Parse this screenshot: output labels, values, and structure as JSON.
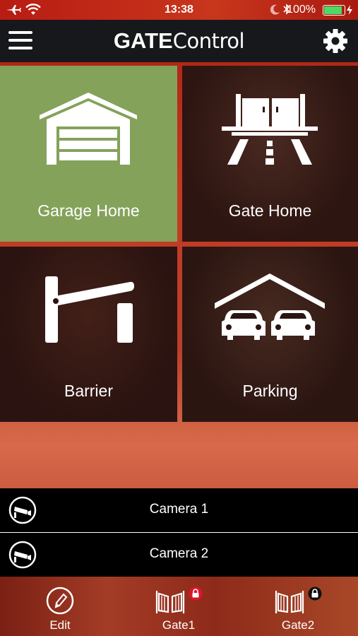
{
  "status_bar": {
    "time": "13:38",
    "battery_percent": "100%",
    "battery_level": 1.0
  },
  "header": {
    "title_bold": "GATE",
    "title_rest": "Control"
  },
  "tiles": [
    {
      "label": "Garage Home",
      "icon": "garage-icon",
      "selected": true,
      "color": "#84a25a"
    },
    {
      "label": "Gate Home",
      "icon": "gate-icon",
      "selected": false
    },
    {
      "label": "Barrier",
      "icon": "barrier-icon",
      "selected": false
    },
    {
      "label": "Parking",
      "icon": "parking-icon",
      "selected": false
    }
  ],
  "cameras": [
    {
      "label": "Camera 1",
      "icon": "camera-icon"
    },
    {
      "label": "Camera 2",
      "icon": "camera-icon"
    }
  ],
  "tab_bar": {
    "items": [
      {
        "label": "Edit",
        "icon": "pencil-icon"
      },
      {
        "label": "Gate1",
        "icon": "gate-icon",
        "lock_color": "#e0142a"
      },
      {
        "label": "Gate2",
        "icon": "gate-icon",
        "lock_color": "#111111"
      }
    ]
  },
  "colors": {
    "accent_red": "#c43a22",
    "tile_selected": "#84a25a",
    "battery_green": "#4cd964"
  }
}
